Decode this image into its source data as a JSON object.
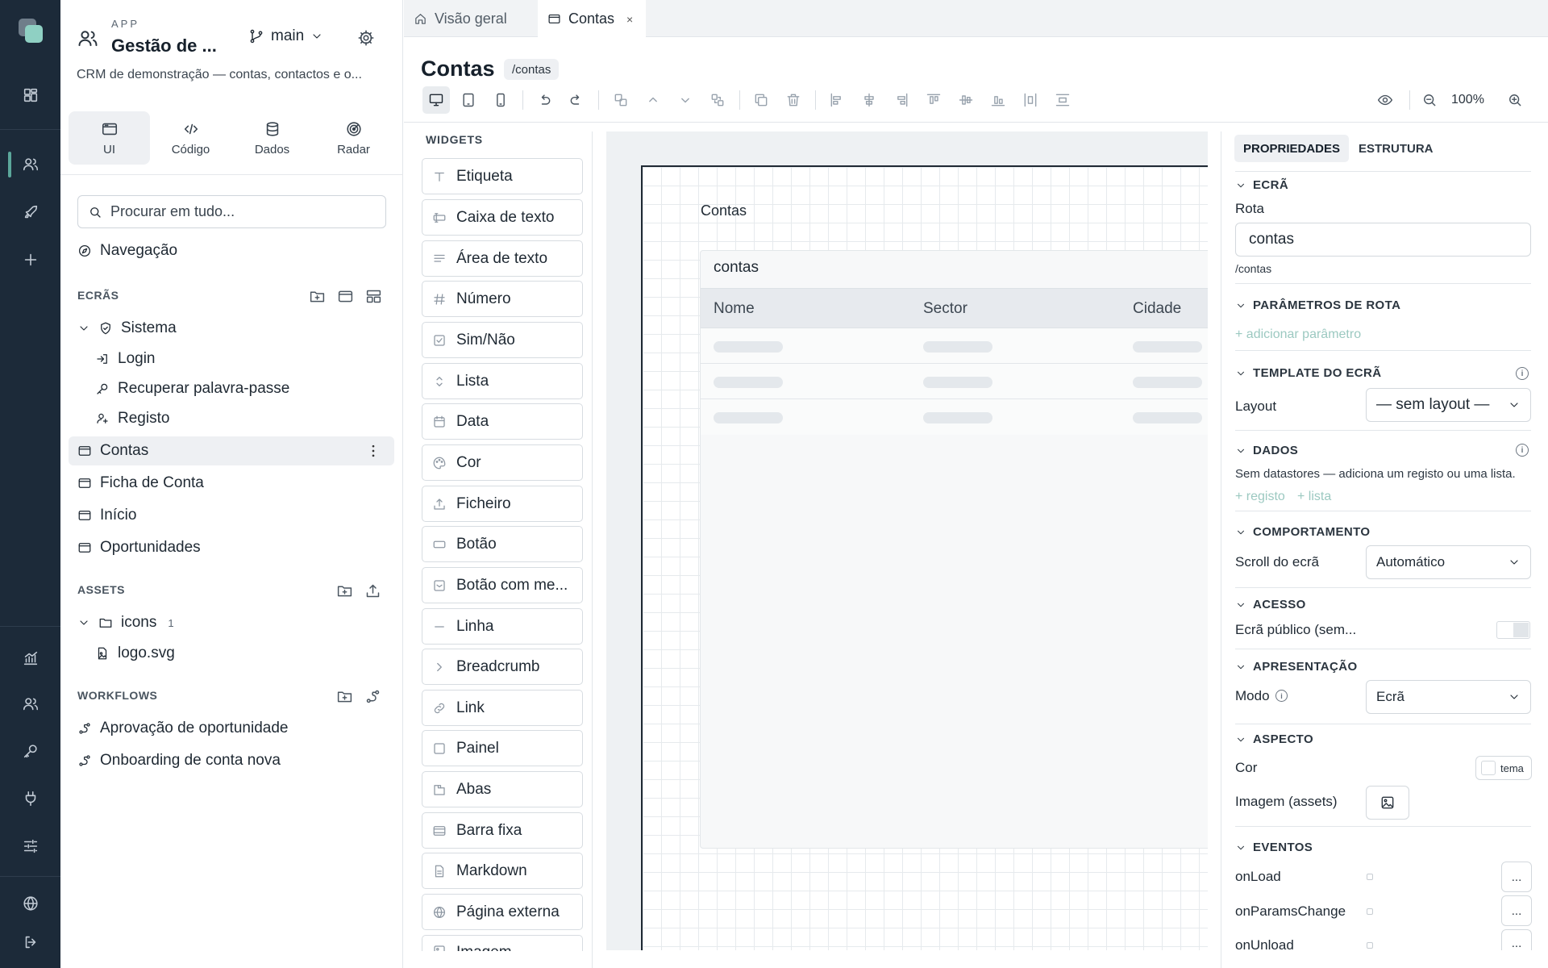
{
  "colors": {
    "rail": "#1c2a39",
    "accent": "#5ba79b",
    "link_add": "#9cc9c1"
  },
  "rail": {
    "icons": [
      "app-logo-icon",
      "dashboard-icon",
      "users-icon",
      "rocket-icon",
      "plus-icon",
      "analytics-icon",
      "team-icon",
      "key-icon",
      "plug-icon",
      "sliders-icon",
      "globe-icon",
      "logout-icon"
    ]
  },
  "app": {
    "kicker": "APP",
    "title": "Gestão de ...",
    "description": "CRM de demonstração — contas, contactos e o...",
    "branch": "main"
  },
  "modes": [
    {
      "label": "UI"
    },
    {
      "label": "Código"
    },
    {
      "label": "Dados"
    },
    {
      "label": "Radar"
    }
  ],
  "search": {
    "placeholder": "Procurar em tudo..."
  },
  "navigation_label": "Navegação",
  "screens": {
    "heading": "ECRÃS",
    "group": "Sistema",
    "group_items": [
      "Login",
      "Recuperar palavra-passe",
      "Registo"
    ],
    "items": [
      "Contas",
      "Ficha de Conta",
      "Início",
      "Oportunidades"
    ]
  },
  "assets": {
    "heading": "ASSETS",
    "folder": "icons",
    "folder_count": "1",
    "file": "logo.svg"
  },
  "workflows": {
    "heading": "WORKFLOWS",
    "items": [
      "Aprovação de oportunidade",
      "Onboarding de conta nova"
    ]
  },
  "tabs": [
    {
      "label": "Visão geral"
    },
    {
      "label": "Contas",
      "close": "×"
    }
  ],
  "screen": {
    "title": "Contas",
    "route": "/contas"
  },
  "toolbar": {
    "zoom": "100%"
  },
  "widgets": {
    "heading": "WIDGETS",
    "items": [
      "Etiqueta",
      "Caixa de texto",
      "Área de texto",
      "Número",
      "Sim/Não",
      "Lista",
      "Data",
      "Cor",
      "Ficheiro",
      "Botão",
      "Botão com me...",
      "Linha",
      "Breadcrumb",
      "Link",
      "Painel",
      "Abas",
      "Barra fixa",
      "Markdown",
      "Página externa",
      "Imagem"
    ]
  },
  "canvas": {
    "label": "Contas",
    "table_title": "contas",
    "columns": [
      "Nome",
      "Sector",
      "Cidade"
    ]
  },
  "props": {
    "tabs": [
      "PROPRIEDADES",
      "ESTRUTURA"
    ],
    "screen_section": "ECRÃ",
    "route_label": "Rota",
    "route_value": "contas",
    "route_hint": "/contas",
    "params_section": "PARÂMETROS DE ROTA",
    "add_param": "+ adicionar parâmetro",
    "template_section": "TEMPLATE DO ECRÃ",
    "layout_label": "Layout",
    "layout_value": "— sem layout —",
    "data_section": "DADOS",
    "data_hint": "Sem datastores — adiciona um registo ou uma lista.",
    "add_record": "+ registo",
    "add_list": "+ lista",
    "behavior_section": "COMPORTAMENTO",
    "scroll_label": "Scroll do ecrã",
    "scroll_value": "Automático",
    "access_section": "ACESSO",
    "public_label": "Ecrã público (sem...",
    "presentation_section": "APRESENTAÇÃO",
    "mode_label": "Modo",
    "mode_value": "Ecrã",
    "aspect_section": "ASPECTO",
    "color_label": "Cor",
    "color_value": "tema",
    "image_label": "Imagem (assets)",
    "events_section": "EVENTOS",
    "events": [
      "onLoad",
      "onParamsChange",
      "onUnload"
    ],
    "event_button": "..."
  }
}
